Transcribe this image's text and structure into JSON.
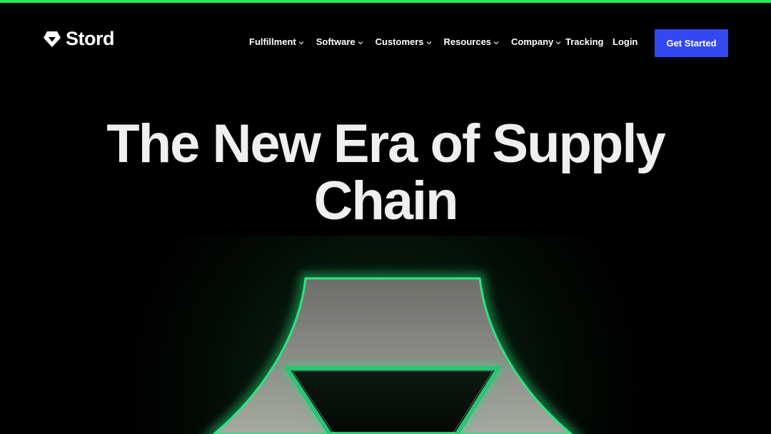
{
  "brand": {
    "name": "Stord",
    "accent_strip_color": "#2be65a",
    "cta_color": "#3448f2",
    "glow_color": "#27d66b"
  },
  "nav": {
    "items": [
      {
        "label": "Fulfillment",
        "has_dropdown": true,
        "icon": "chevron-down-icon"
      },
      {
        "label": "Software",
        "has_dropdown": true,
        "icon": "chevron-down-icon"
      },
      {
        "label": "Customers",
        "has_dropdown": true,
        "icon": "chevron-down-icon"
      },
      {
        "label": "Resources",
        "has_dropdown": true,
        "icon": "chevron-down-icon"
      },
      {
        "label": "Company",
        "has_dropdown": true,
        "icon": "chevron-down-icon"
      }
    ],
    "tracking_label": "Tracking",
    "login_label": "Login",
    "cta_label": "Get Started"
  },
  "hero": {
    "title": "The New Era of Supply Chain"
  }
}
